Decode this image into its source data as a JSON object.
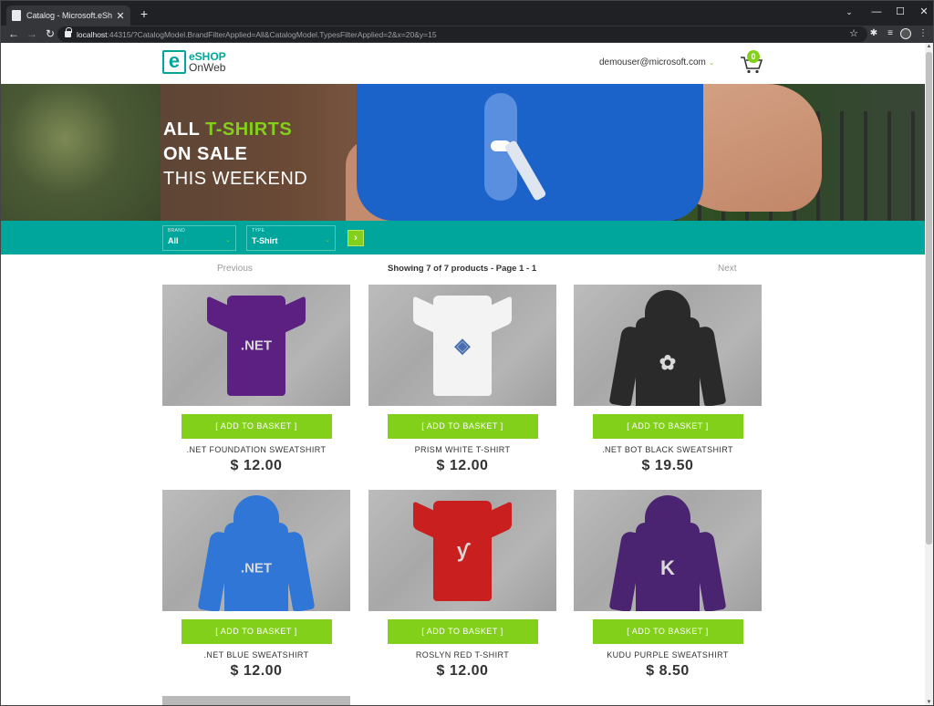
{
  "browser": {
    "tab_title": "Catalog - Microsoft.eShopOnWe",
    "tab_close": "✕",
    "new_tab": "+",
    "window_controls": {
      "chevron": "⌄",
      "minimize": "—",
      "maximize": "☐",
      "close": "✕"
    },
    "url_host": "localhost",
    "url_rest": ":44315/?CatalogModel.BrandFilterApplied=All&CatalogModel.TypesFilterApplied=2&x=20&y=15",
    "icons": {
      "back": "←",
      "forward": "→",
      "reload": "↻",
      "star": "☆",
      "extensions": "✱",
      "media": "≡",
      "menu": "⋮"
    }
  },
  "header": {
    "logo_mark": "e",
    "logo_line1": "eSHOP",
    "logo_line2": "OnWeb",
    "user_email": "demouser@microsoft.com",
    "user_chevron": "⌄",
    "basket_count": "0"
  },
  "hero": {
    "line1_plain": "ALL ",
    "line1_accent": "T-SHIRTS",
    "line2": "ON SALE",
    "line3": "THIS WEEKEND"
  },
  "filters": {
    "brand_label": "BRAND",
    "brand_value": "All",
    "type_label": "TYPE",
    "type_value": "T-Shirt",
    "chevron": "⌄",
    "apply_icon": "›"
  },
  "pager": {
    "previous": "Previous",
    "info": "Showing 7 of 7 products - Page 1 - 1",
    "next": "Next"
  },
  "products": [
    {
      "name": ".NET FOUNDATION SWEATSHIRT",
      "price": "$ 12.00",
      "button": "[ ADD TO BASKET ]",
      "garment": "tee",
      "color": "#5c1f82",
      "print": ".NET"
    },
    {
      "name": "PRISM WHITE T-SHIRT",
      "price": "$ 12.00",
      "button": "[ ADD TO BASKET ]",
      "garment": "tee",
      "color": "#f3f3f3",
      "print": "◈"
    },
    {
      "name": ".NET BOT BLACK SWEATSHIRT",
      "price": "$ 19.50",
      "button": "[ ADD TO BASKET ]",
      "garment": "hoodie",
      "color": "#2a2a2a",
      "print": "✿"
    },
    {
      "name": ".NET BLUE SWEATSHIRT",
      "price": "$ 12.00",
      "button": "[ ADD TO BASKET ]",
      "garment": "hoodie",
      "color": "#2f76d6",
      "print": ".NET"
    },
    {
      "name": "ROSLYN RED T-SHIRT",
      "price": "$ 12.00",
      "button": "[ ADD TO BASKET ]",
      "garment": "tee",
      "color": "#c91f1f",
      "print": "ƴ"
    },
    {
      "name": "KUDU PURPLE SWEATSHIRT",
      "price": "$ 8.50",
      "button": "[ ADD TO BASKET ]",
      "garment": "hoodie",
      "color": "#4a2470",
      "print": "K"
    }
  ],
  "colors": {
    "brand_teal": "#00a69c",
    "accent_green": "#83d01b",
    "text_dark": "#333333"
  }
}
